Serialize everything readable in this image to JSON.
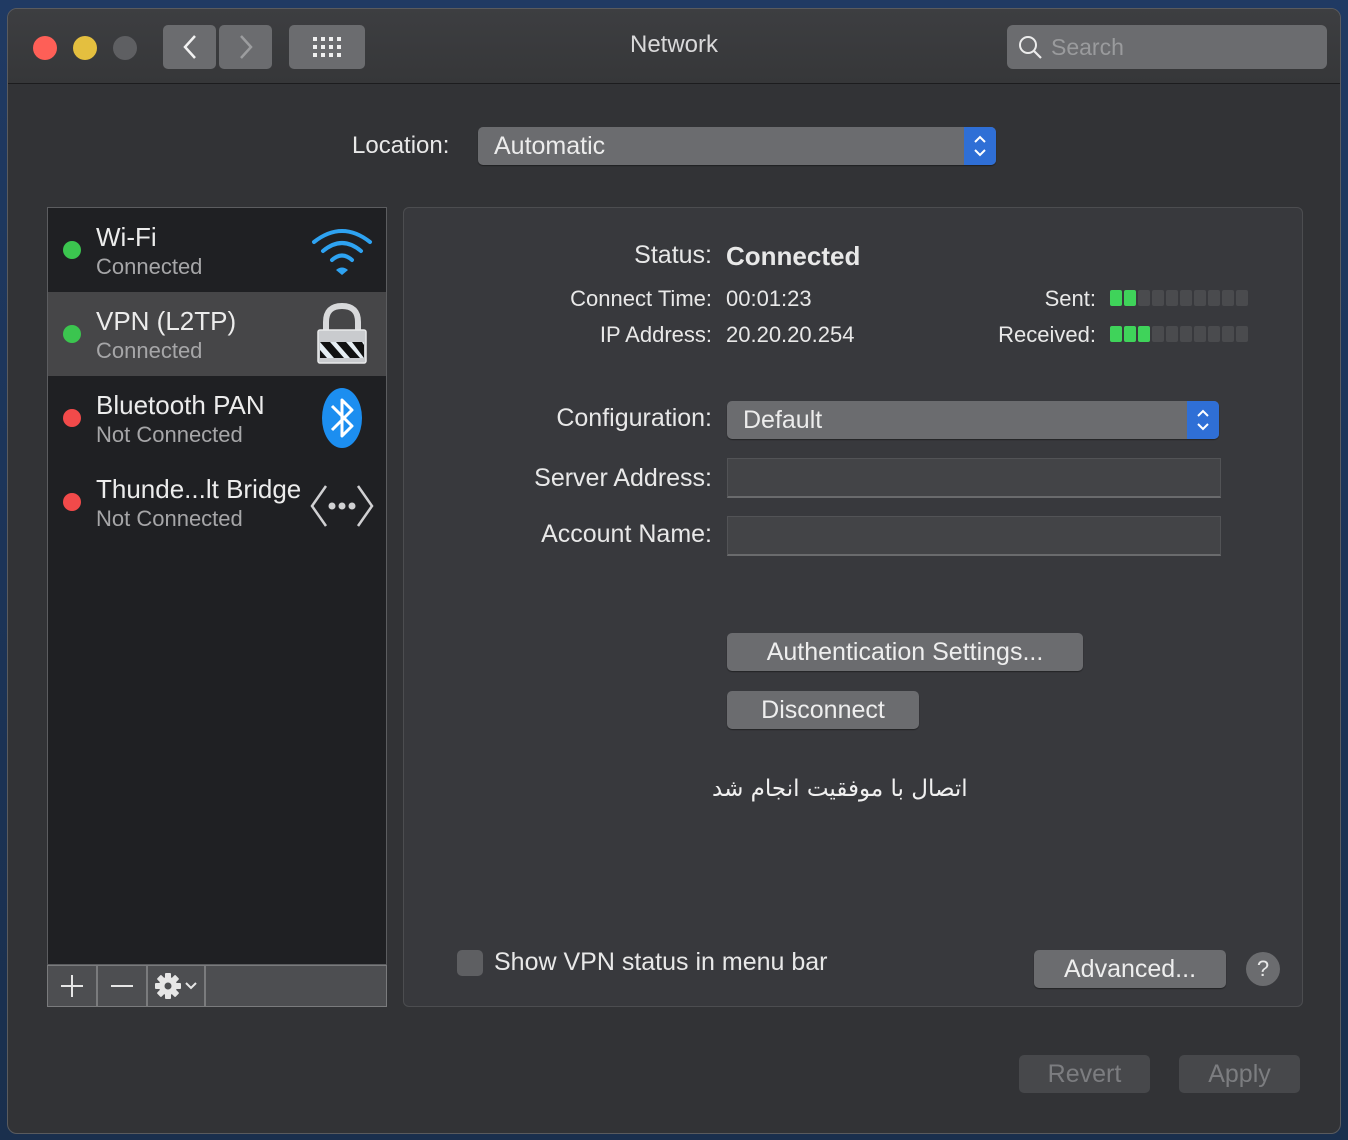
{
  "window": {
    "title": "Network",
    "search_placeholder": "Search"
  },
  "location": {
    "label": "Location:",
    "value": "Automatic"
  },
  "services": [
    {
      "name": "Wi-Fi",
      "status": "Connected",
      "state": "connected",
      "icon": "wifi-icon"
    },
    {
      "name": "VPN (L2TP)",
      "status": "Connected",
      "state": "connected",
      "icon": "lock-icon",
      "selected": true
    },
    {
      "name": "Bluetooth PAN",
      "status": "Not Connected",
      "state": "disconnected",
      "icon": "bluetooth-icon"
    },
    {
      "name": "Thunde...lt Bridge",
      "status": "Not Connected",
      "state": "disconnected",
      "icon": "thunderbolt-bridge-icon"
    }
  ],
  "colors": {
    "connected": "#3bc54f",
    "disconnected": "#f24a4a",
    "accent": "#2f6fd6"
  },
  "sidebar_toolbar": {
    "add": "+",
    "remove": "—"
  },
  "detail": {
    "status_label": "Status:",
    "status_value": "Connected",
    "connect_time_label": "Connect Time:",
    "connect_time_value": "00:01:23",
    "ip_label": "IP Address:",
    "ip_value": "20.20.20.254",
    "sent_label": "Sent:",
    "sent_level": 2,
    "received_label": "Received:",
    "received_level": 3,
    "meter_segments": 10,
    "configuration_label": "Configuration:",
    "configuration_value": "Default",
    "server_label": "Server Address:",
    "server_value": "",
    "account_label": "Account Name:",
    "account_value": "",
    "auth_button": "Authentication Settings...",
    "disconnect_button": "Disconnect",
    "message": "اتصال با موفقیت انجام شد",
    "show_vpn_label": "Show VPN status in menu bar",
    "show_vpn_checked": false,
    "advanced_button": "Advanced...",
    "help": "?"
  },
  "footer": {
    "revert": "Revert",
    "apply": "Apply"
  }
}
